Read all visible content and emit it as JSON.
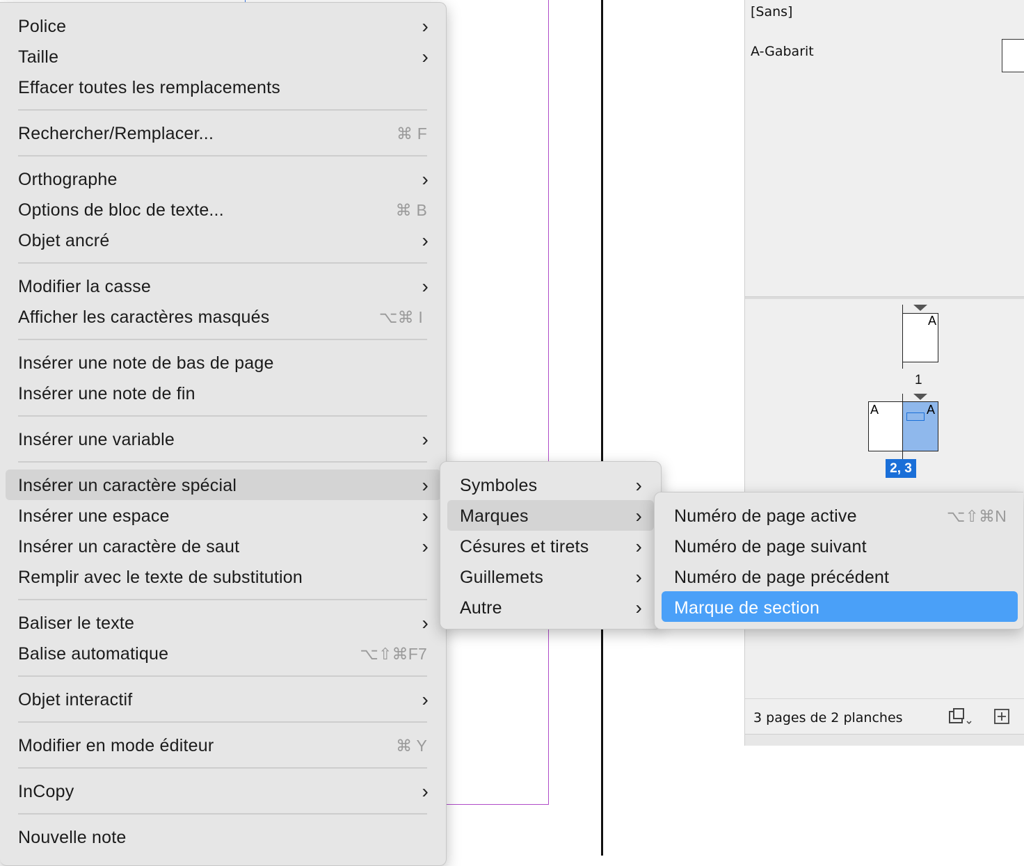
{
  "main_menu": {
    "items": [
      {
        "label": "Police",
        "submenu": true
      },
      {
        "label": "Taille",
        "submenu": true
      },
      {
        "label": "Effacer toutes les remplacements"
      },
      {
        "label": "Rechercher/Remplacer...",
        "shortcut": "⌘ F"
      },
      {
        "label": "Orthographe",
        "submenu": true
      },
      {
        "label": "Options de bloc de texte...",
        "shortcut": "⌘ B"
      },
      {
        "label": "Objet ancré",
        "submenu": true
      },
      {
        "label": "Modifier la casse",
        "submenu": true
      },
      {
        "label": "Afficher les caractères masqués",
        "shortcut": "⌥⌘ I"
      },
      {
        "label": "Insérer une note de bas de page"
      },
      {
        "label": "Insérer une note de fin"
      },
      {
        "label": "Insérer une variable",
        "submenu": true
      },
      {
        "label": "Insérer un caractère spécial",
        "submenu": true,
        "highlighted": true
      },
      {
        "label": "Insérer une espace",
        "submenu": true
      },
      {
        "label": "Insérer un caractère de saut",
        "submenu": true
      },
      {
        "label": "Remplir avec le texte de substitution"
      },
      {
        "label": "Baliser le texte",
        "submenu": true
      },
      {
        "label": "Balise automatique",
        "shortcut": "⌥⇧⌘F7"
      },
      {
        "label": "Objet interactif",
        "submenu": true
      },
      {
        "label": "Modifier en mode éditeur",
        "shortcut": "⌘ Y"
      },
      {
        "label": "InCopy",
        "submenu": true
      },
      {
        "label": "Nouvelle note"
      }
    ],
    "chevron": "›"
  },
  "submenu_special": {
    "items": [
      {
        "label": "Symboles",
        "submenu": true
      },
      {
        "label": "Marques",
        "submenu": true,
        "highlighted": true
      },
      {
        "label": "Césures et tirets",
        "submenu": true
      },
      {
        "label": "Guillemets",
        "submenu": true
      },
      {
        "label": "Autre",
        "submenu": true
      }
    ]
  },
  "submenu_marques": {
    "items": [
      {
        "label": "Numéro de page active",
        "shortcut": "⌥⇧⌘N"
      },
      {
        "label": "Numéro de page suivant"
      },
      {
        "label": "Numéro de page précédent"
      },
      {
        "label": "Marque de section",
        "selected": true
      }
    ]
  },
  "pages_panel": {
    "masters": [
      "[Sans]",
      "A-Gabarit"
    ],
    "page1_label": "1",
    "spread_label": "2, 3",
    "master_letter": "A",
    "footer": "3 pages de 2 planches",
    "icons": [
      "edit-page-size-icon",
      "new-page-icon"
    ]
  },
  "colors": {
    "menu_bg": "#e6e6e6",
    "selection_blue": "#4aa0f8",
    "spread_selection": "#1a6fd8",
    "page_highlight": "#8fb8ec"
  }
}
